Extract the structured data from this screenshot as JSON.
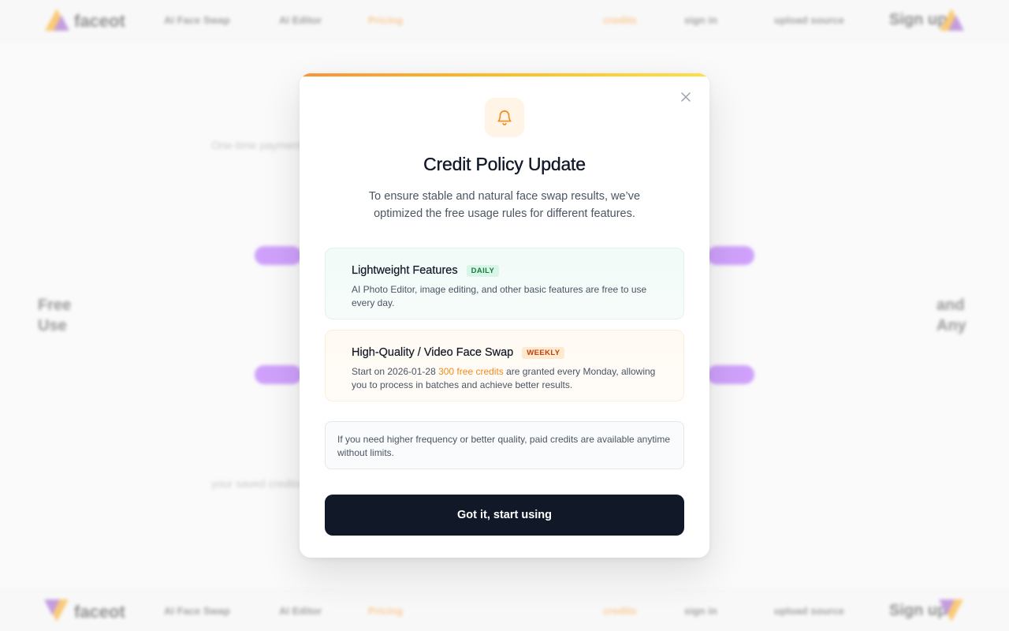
{
  "background": {
    "nav_top": {
      "brand": "faceot",
      "items": [
        "AI Face Swap",
        "AI Editor",
        "Pricing"
      ],
      "right_items": [
        "credits",
        "sign in",
        "upload source",
        "Sign up"
      ]
    },
    "nav_bottom": {
      "brand": "faceot",
      "items": [
        "AI Face Swap",
        "AI Editor",
        "Pricing"
      ],
      "right_items": [
        "credits",
        "sign in",
        "upload source",
        "Sign up"
      ]
    },
    "line_1": "One-time payment, credits never expire, use them anytime for face swap work and",
    "line_2": "your saved credits carry over, billing is simple and transparent for everyone to use",
    "left_big": [
      "Free",
      "Use"
    ],
    "right_big": [
      "and",
      "Any"
    ]
  },
  "modal": {
    "title": "Credit Policy Update",
    "description": "To ensure stable and natural face swap results, we’ve optimized the free usage rules for different features.",
    "features": [
      {
        "title": "Lightweight Features",
        "badge": "DAILY",
        "text": "AI Photo Editor, image editing, and other basic features are free to use every day."
      },
      {
        "title": "High-Quality / Video Face Swap",
        "badge": "WEEKLY",
        "text_prefix": "Start on 2026-01-28 ",
        "text_highlight": "300 free credits",
        "text_suffix": " are granted every Monday, allowing you to process in batches and achieve better results."
      }
    ],
    "note": "If you need higher frequency or better quality, paid credits are available anytime without limits.",
    "cta_label": "Got it, start using"
  },
  "colors": {
    "accent_orange": "#f28c1c",
    "button_dark": "#111827",
    "daily_badge": "#15803d",
    "weekly_badge": "#c2410c"
  }
}
